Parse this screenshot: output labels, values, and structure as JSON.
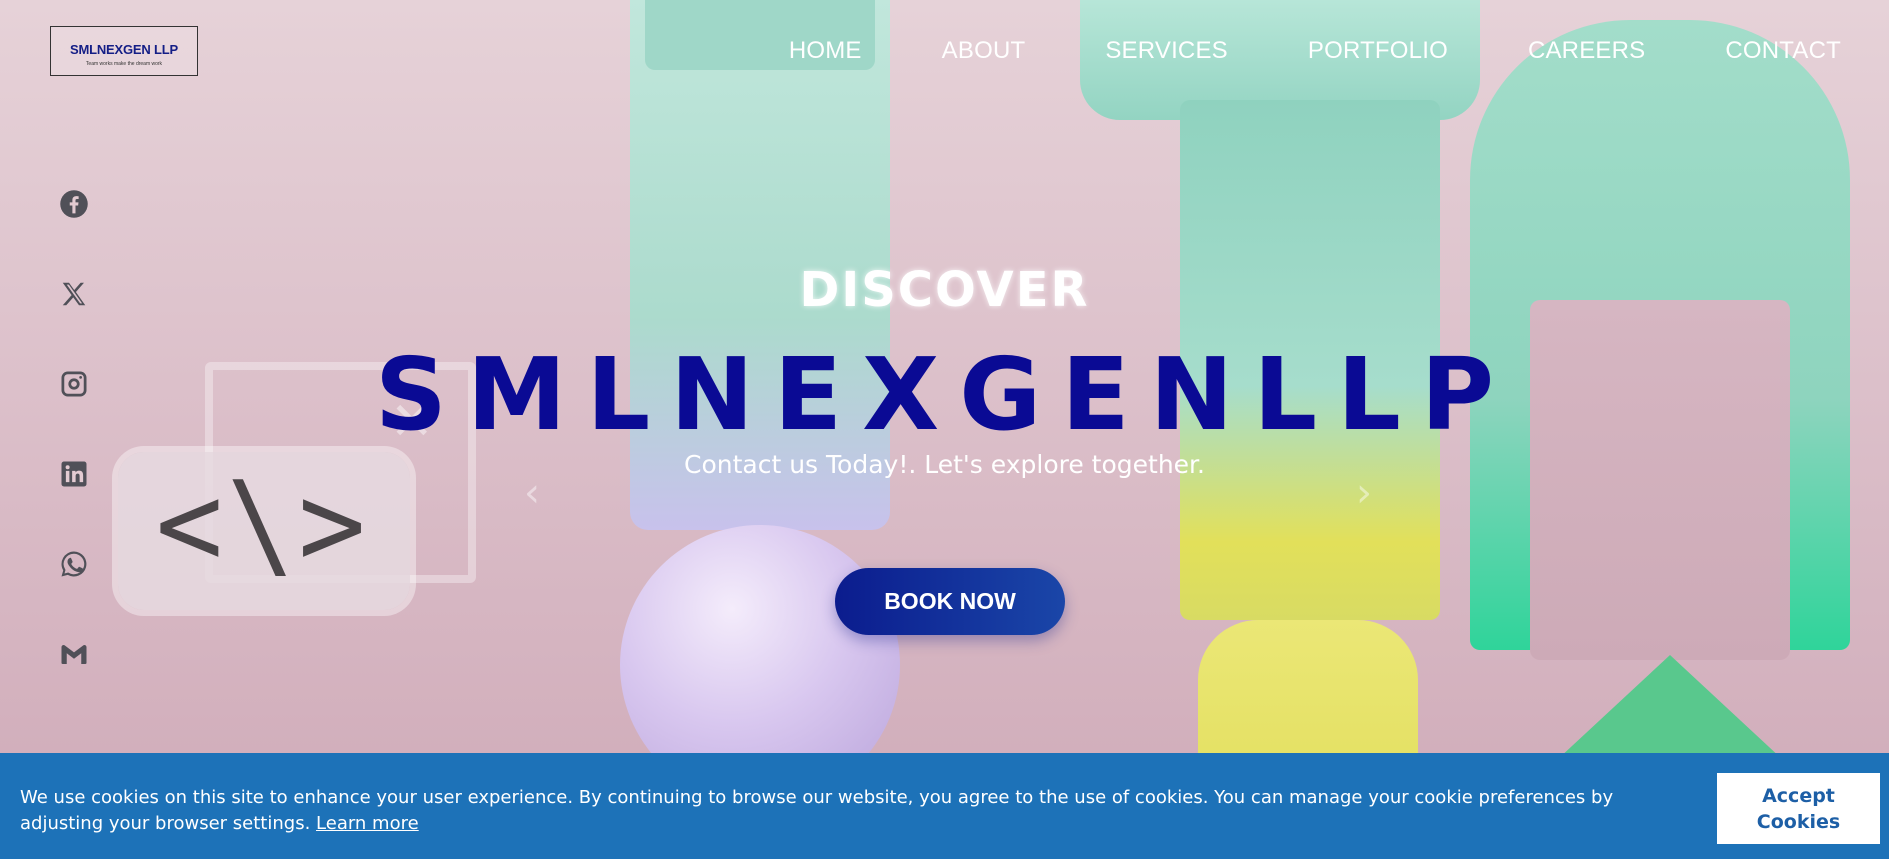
{
  "brand": {
    "logo_text": "SMLNEXGEN LLP",
    "logo_tagline": "Team works make the dream work"
  },
  "nav": {
    "items": [
      "HOME",
      "ABOUT",
      "SERVICES",
      "PORTFOLIO",
      "CAREERS",
      "CONTACT"
    ]
  },
  "social": [
    "facebook-icon",
    "x-twitter-icon",
    "instagram-icon",
    "linkedin-icon",
    "whatsapp-icon",
    "gmail-icon"
  ],
  "hero": {
    "eyebrow": "DISCOVER",
    "title": "SMLNEXGENLLP",
    "subtitle": "Contact us Today!. Let's explore together.",
    "cta": "BOOK NOW",
    "code_symbol": "<\\>",
    "prev_arrow": "‹",
    "next_arrow": "›"
  },
  "cookie": {
    "message": "We use cookies on this site to enhance your user experience. By continuing to browse our website, you agree to the use of cookies. You can manage your cookie preferences by adjusting your browser settings.",
    "learn_more": "Learn more",
    "accept": "Accept Cookies"
  },
  "colors": {
    "brand_blue": "#0a0a94",
    "cookie_bar": "#1d72b8",
    "cta_start": "#0b1c8e",
    "cta_end": "#1a46a8"
  }
}
